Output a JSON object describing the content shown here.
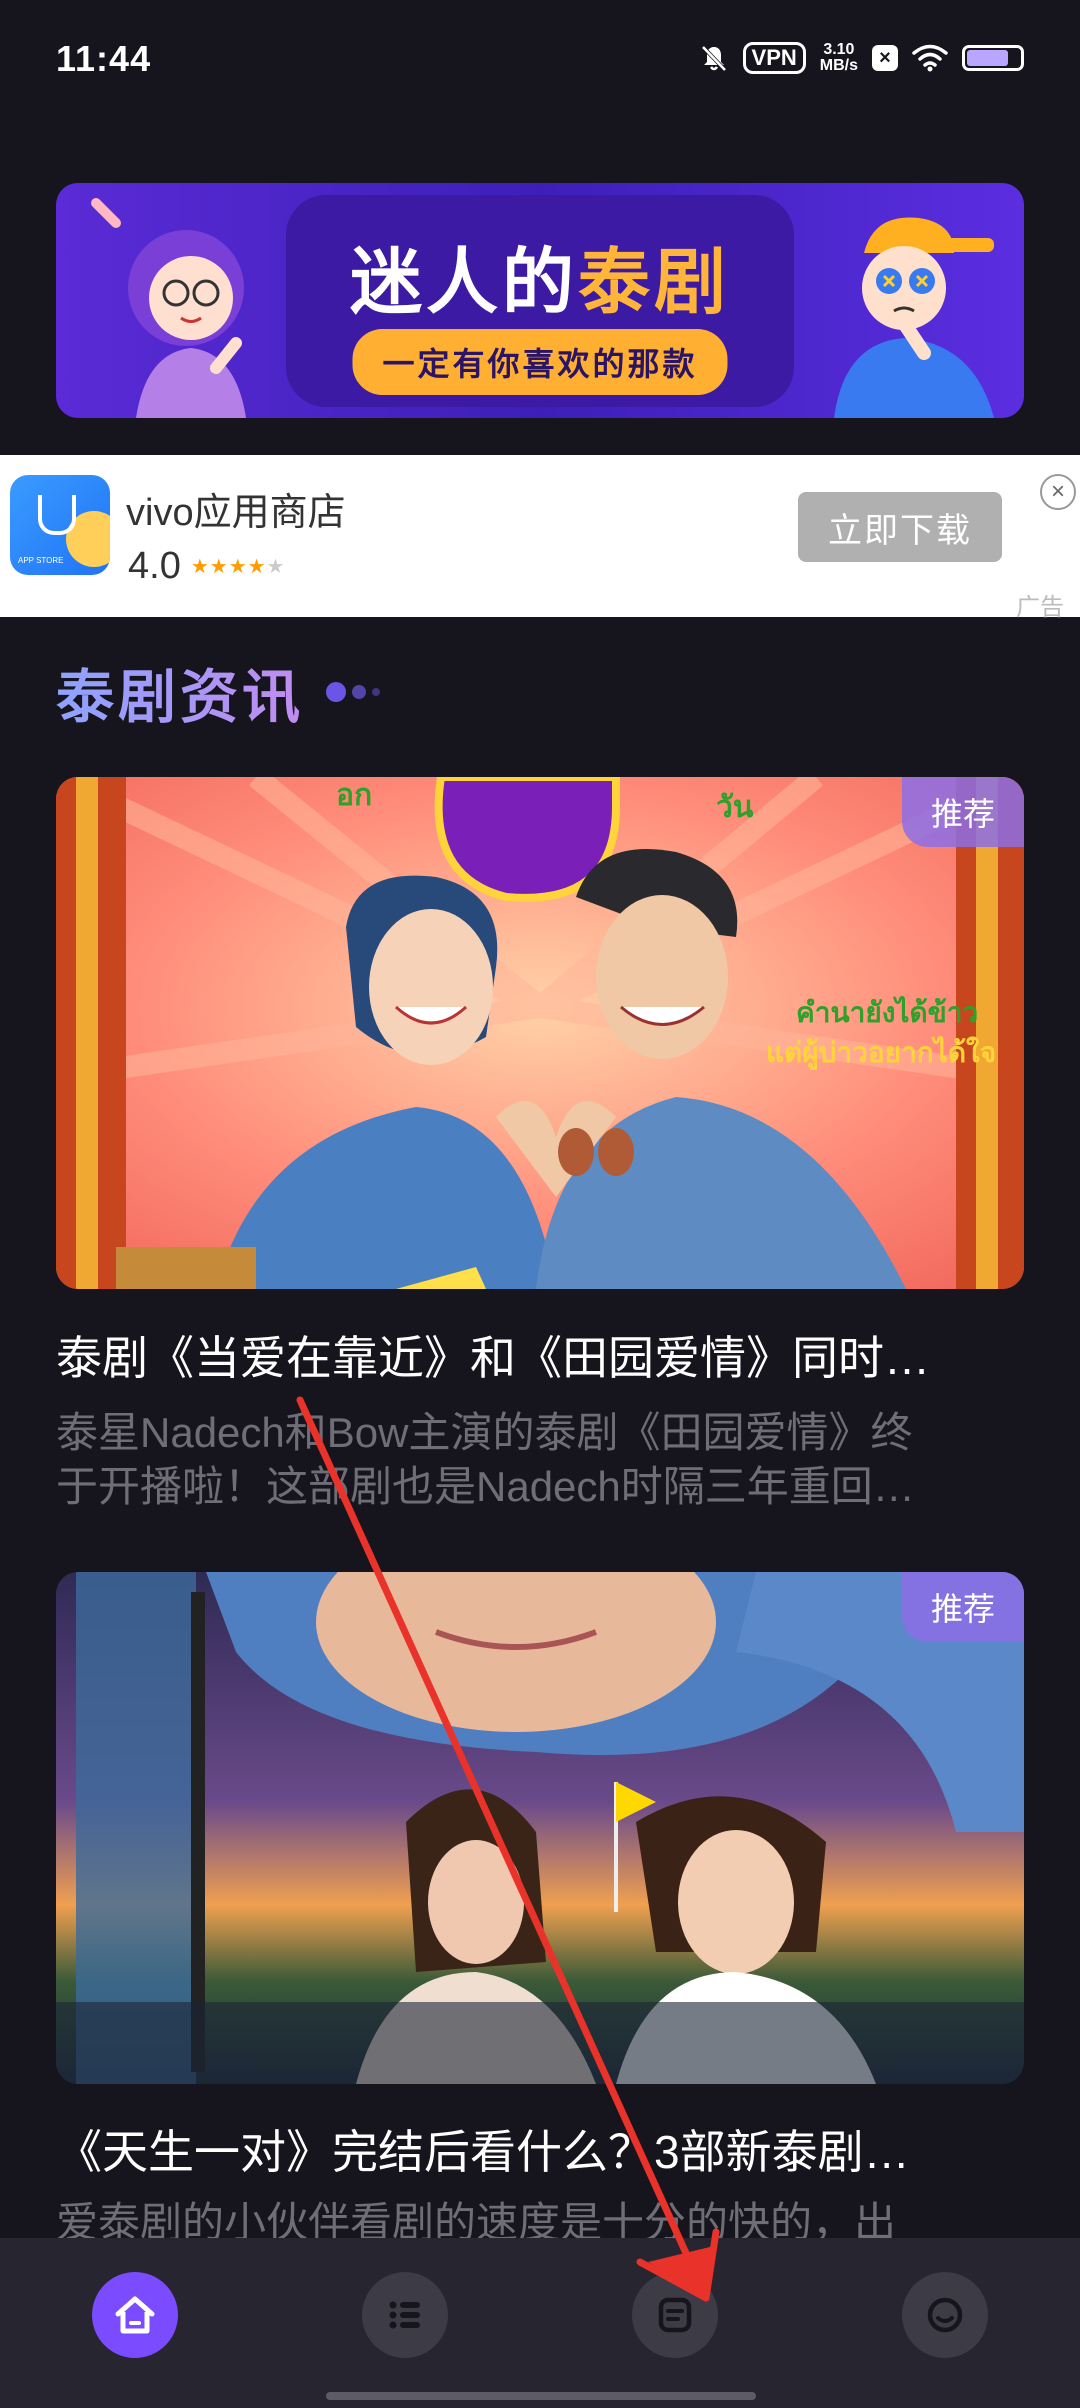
{
  "status_bar": {
    "time": "11:44",
    "vpn": "VPN",
    "speed_value": "3.10",
    "speed_unit": "MB/s",
    "x_label": "×"
  },
  "banner": {
    "title_part1": "迷人的",
    "title_part2": "泰剧",
    "subtitle": "一定有你喜欢的那款",
    "colors": {
      "background": "#4a25c8",
      "highlight": "#ffb43a"
    }
  },
  "ad": {
    "app_name": "vivo应用商店",
    "rating": "4.0",
    "stars": 4,
    "logo_text": "APP STORE",
    "button_label": "立即下载",
    "close_label": "×",
    "ad_label": "广告"
  },
  "section": {
    "title": "泰剧资讯"
  },
  "articles": [
    {
      "tag": "推荐",
      "title": "泰剧《当爱在靠近》和《田园爱情》同时…",
      "desc_line1": "泰星Nadech和Bow主演的泰剧《田园爱情》终",
      "desc_line2": "于开播啦！这部剧也是Nadech时隔三年重回…",
      "image_text_1": "อก",
      "image_text_2": "วัน",
      "image_text_3": "คำนายังได้ข้าว",
      "image_text_4": "แต่ผู้บ่าวอยากได้ใจ"
    },
    {
      "tag": "推荐",
      "title": "《天生一对》完结后看什么？3部新泰剧…",
      "desc_line1": "爱泰剧的小伙伴看剧的速度是十分的快的，出"
    }
  ],
  "bottom_nav": {
    "items": [
      {
        "name": "home",
        "icon": "home-icon",
        "active": true
      },
      {
        "name": "list",
        "icon": "list-icon",
        "active": false
      },
      {
        "name": "article",
        "icon": "article-icon",
        "active": false
      },
      {
        "name": "profile",
        "icon": "face-icon",
        "active": false
      }
    ],
    "accent": "#7b4cff"
  }
}
